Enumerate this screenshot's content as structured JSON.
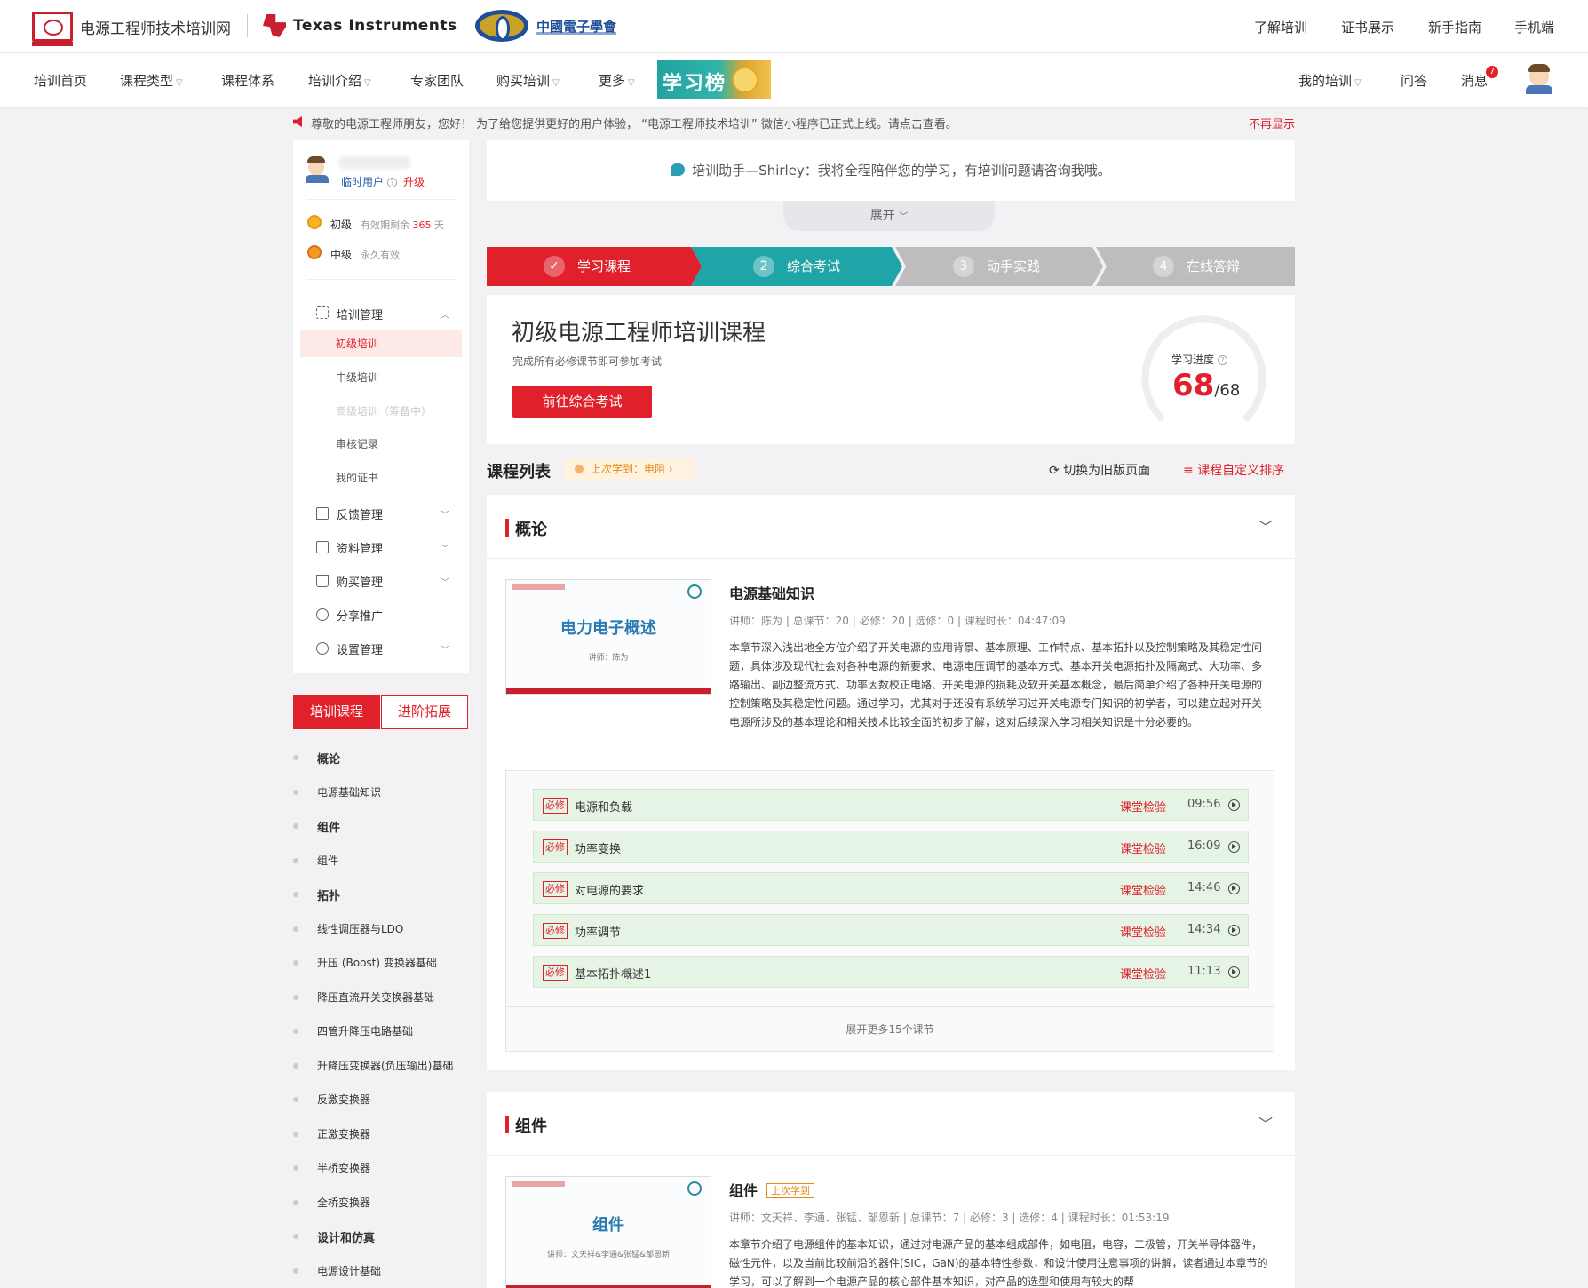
{
  "header": {
    "site_name": "电源工程师技术培训网",
    "ti_name": "Texas Instruments",
    "cie_name": "中國電子學會",
    "links": [
      "了解培训",
      "证书展示",
      "新手指南",
      "手机端"
    ]
  },
  "nav": {
    "items": [
      "培训首页",
      "课程类型",
      "课程体系",
      "培训介绍",
      "专家团队",
      "购买培训",
      "更多"
    ],
    "leaderboard": "学习榜",
    "right": [
      "我的培训",
      "问答",
      "消息"
    ],
    "message_count": "7"
  },
  "notice": {
    "text": "尊敬的电源工程师朋友，您好！ 为了给您提供更好的用户体验， “电源工程师技术培训” 微信小程序已正式上线。请点击查看。",
    "dismiss": "不再显示"
  },
  "sidebar": {
    "user_type": "临时用户",
    "upgrade": "升级",
    "levels": [
      {
        "name": "初级",
        "valid_prefix": "有效期剩余",
        "days": "365",
        "valid_suffix": "天"
      },
      {
        "name": "中级",
        "valid": "永久有效"
      }
    ],
    "training_mgmt": "培训管理",
    "sub": [
      "初级培训",
      "中级培训",
      "高级培训（筹备中）",
      "审核记录",
      "我的证书"
    ],
    "menus": [
      "反馈管理",
      "资料管理",
      "购买管理",
      "分享推广",
      "设置管理"
    ]
  },
  "left_tabs": {
    "active": "培训课程",
    "inactive": "进阶拓展"
  },
  "left_list": [
    {
      "label": "概论",
      "cat": true
    },
    {
      "label": "电源基础知识",
      "cat": false
    },
    {
      "label": "组件",
      "cat": true
    },
    {
      "label": "组件",
      "cat": false
    },
    {
      "label": "拓扑",
      "cat": true
    },
    {
      "label": "线性调压器与LDO",
      "cat": false
    },
    {
      "label": "升压 (Boost) 变换器基础",
      "cat": false
    },
    {
      "label": "降压直流开关变换器基础",
      "cat": false
    },
    {
      "label": "四管升降压电路基础",
      "cat": false
    },
    {
      "label": "升降压变换器(负压输出)基础",
      "cat": false
    },
    {
      "label": "反激变换器",
      "cat": false
    },
    {
      "label": "正激变换器",
      "cat": false
    },
    {
      "label": "半桥变换器",
      "cat": false
    },
    {
      "label": "全桥变换器",
      "cat": false
    },
    {
      "label": "设计和仿真",
      "cat": true
    },
    {
      "label": "电源设计基础",
      "cat": false
    }
  ],
  "assistant": {
    "text": "培训助手—Shirley：我将全程陪伴您的学习，有培训问题请咨询我哦。",
    "expand": "展开"
  },
  "steps": [
    "学习课程",
    "综合考试",
    "动手实践",
    "在线答辩"
  ],
  "step_numbers": [
    "2",
    "3",
    "4"
  ],
  "course": {
    "title": "初级电源工程师培训课程",
    "subtitle": "完成所有必修课节即可参加考试",
    "exam_button": "前往综合考试",
    "progress_label": "学习进度",
    "progress_done": "68",
    "progress_total": "/68",
    "progress_fraction": 1.0
  },
  "course_list": {
    "title": "课程列表",
    "last_study": "上次学到：电阻",
    "switch_old": "切换为旧版页面",
    "custom_sort": "课程自定义排序"
  },
  "sections": [
    {
      "name": "概论",
      "item": {
        "thumb_title": "电力电子概述",
        "thumb_teacher": "讲师：陈为",
        "title": "电源基础知识",
        "meta": "讲师：陈为  |  总课节：20  |  必修：20  |  选修：0  |  课程时长：04:47:09",
        "desc": "本章节深入浅出地全方位介绍了开关电源的应用背景、基本原理、工作特点、基本拓扑以及控制策略及其稳定性问题，具体涉及现代社会对各种电源的新要求、电源电压调节的基本方式、基本开关电源拓扑及隔离式、大功率、多路输出、副边整流方式、功率因数校正电路、开关电源的损耗及软开关基本概念，最后简单介绍了各种开关电源的控制策略及其稳定性问题。通过学习，尤其对于还没有系统学习过开关电源专门知识的初学者，可以建立起对开关电源所涉及的基本理论和相关技术比较全面的初步了解，这对后续深入学习相关知识是十分必要的。",
        "lessons": [
          {
            "tag": "必修",
            "name": "电源和负载",
            "check": "课堂检验",
            "time": "09:56"
          },
          {
            "tag": "必修",
            "name": "功率变换",
            "check": "课堂检验",
            "time": "16:09"
          },
          {
            "tag": "必修",
            "name": "对电源的要求",
            "check": "课堂检验",
            "time": "14:46"
          },
          {
            "tag": "必修",
            "name": "功率调节",
            "check": "课堂检验",
            "time": "14:34"
          },
          {
            "tag": "必修",
            "name": "基本拓扑概述1",
            "check": "课堂检验",
            "time": "11:13"
          }
        ],
        "more": "展开更多15个课节"
      }
    },
    {
      "name": "组件",
      "item": {
        "thumb_title": "组件",
        "thumb_teacher": "讲师：文天祥&李通&张锰&邹恩新",
        "title": "组件",
        "tag": "上次学到",
        "meta": "讲师：文天祥、李通、张锰、邹恩新  |  总课节：7  |  必修：3  |  选修：4  |  课程时长：01:53:19",
        "desc": "本章节介绍了电源组件的基本知识，通过对电源产品的基本组成部件，如电阻，电容，二极管，开关半导体器件，磁性元件，以及当前比较前沿的器件(SIC，GaN)的基本特性参数，和设计使用注意事项的讲解，读者通过本章节的学习，可以了解到一个电源产品的核心部件基本知识，对产品的选型和使用有较大的帮"
      }
    }
  ],
  "colors": {
    "accent": "#e0212b",
    "teal": "#1fa4a8",
    "gray_step": "#bdbdbd"
  }
}
